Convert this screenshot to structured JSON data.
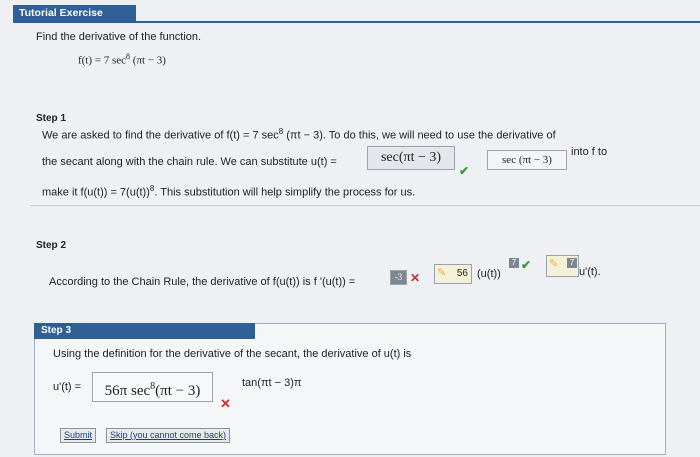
{
  "header": {
    "title": "Tutorial Exercise"
  },
  "problem": {
    "prompt": "Find the derivative of the function.",
    "function_lhs": "f(t) = 7 sec",
    "function_exp": "8",
    "function_rhs": "(πt − 3)"
  },
  "step1": {
    "label": "Step 1",
    "line1_a": "We are asked to find the derivative of ",
    "line1_f": "f(t) = 7 sec",
    "line1_exp": "8",
    "line1_b": " (πt − 3). To do this, we will need to use the derivative of",
    "line2_a": "the secant along with the chain rule. We can substitute ",
    "line2_u": "u(t) =",
    "answer_box": "sec(πt − 3)",
    "correct_box": "sec (πt − 3)",
    "into": "into f to",
    "line3_a": "make it f(u(t)) = 7(u(t))",
    "line3_exp": "8",
    "line3_b": ". This substitution will help simplify the process for us."
  },
  "step2": {
    "label": "Step 2",
    "text": "According to the Chain Rule, the derivative of f(u(t)) is f '(u(t)) =",
    "answer_box": "-3",
    "box2_value": "56",
    "ut_text": "(u(t))",
    "badge1": "7",
    "badge2": "7",
    "tail": "u'(t)."
  },
  "step3": {
    "label": "Step 3",
    "text": "Using the definition for the derivative of the secant, the derivative of u(t) is",
    "lhs": "u'(t) =",
    "answer_box": "56π sec",
    "answer_exp": "8",
    "answer_tail": "(πt − 3)",
    "right_text": "tan(πt − 3)π",
    "submit": "Submit",
    "skip": "Skip (you cannot come back)"
  }
}
